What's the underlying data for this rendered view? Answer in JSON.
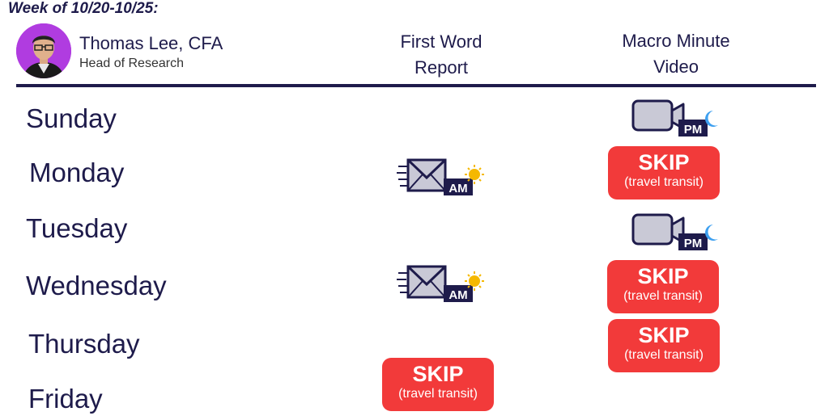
{
  "week_label": "Week of 10/20-10/25:",
  "person": {
    "name": "Thomas Lee, CFA",
    "title": "Head of Research"
  },
  "columns": {
    "first_word_line1": "First Word",
    "first_word_line2": "Report",
    "macro_line1": "Macro Minute",
    "macro_line2": "Video"
  },
  "days": [
    "Sunday",
    "Monday",
    "Tuesday",
    "Wednesday",
    "Thursday",
    "Friday"
  ],
  "badges": {
    "am": "AM",
    "pm": "PM"
  },
  "skip": {
    "label": "SKIP",
    "reason": "(travel transit)"
  },
  "icons": {
    "email": "email-icon",
    "video": "video-camera-icon",
    "sun": "sun-icon",
    "moon": "moon-icon"
  },
  "colors": {
    "navy": "#1e1b4b",
    "skip_red": "#f23a3a",
    "avatar_bg": "#b03ce0",
    "sun": "#f5b800",
    "moon": "#3ea0f0"
  }
}
